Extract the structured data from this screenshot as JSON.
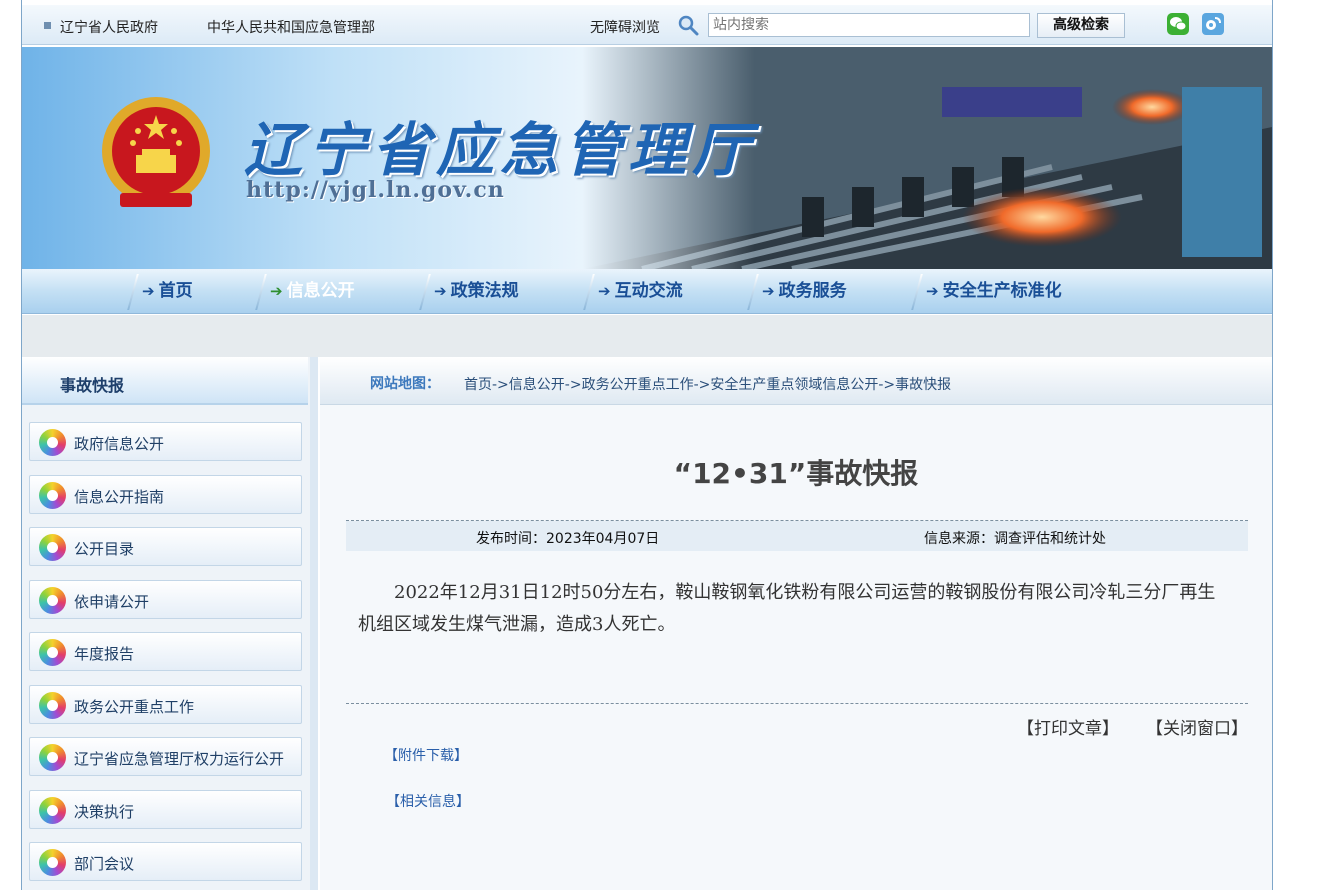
{
  "topbar": {
    "links": [
      "辽宁省人民政府",
      "中华人民共和国应急管理部"
    ],
    "accessibility": "无障碍浏览",
    "search_placeholder": "站内搜索",
    "advanced_search": "高级检索"
  },
  "banner": {
    "title": "辽宁省应急管理厅",
    "url": "http://yjgl.ln.gov.cn"
  },
  "nav": {
    "items": [
      "首页",
      "信息公开",
      "政策法规",
      "互动交流",
      "政务服务",
      "安全生产标准化"
    ],
    "active": "信息公开",
    "arrow": "➔"
  },
  "sidebar": {
    "title": "事故快报",
    "items": [
      "政府信息公开",
      "信息公开指南",
      "公开目录",
      "依申请公开",
      "年度报告",
      "政务公开重点工作",
      "辽宁省应急管理厅权力运行公开",
      "决策执行",
      "部门会议"
    ]
  },
  "main": {
    "sitemap_label": "网站地图：",
    "breadcrumb": "首页->信息公开->政务公开重点工作->安全生产重点领域信息公开->事故快报",
    "title": "“12•31”事故快报",
    "publish_date": "发布时间：2023年04月07日",
    "source": "信息来源：调查评估和统计处",
    "body": "2022年12月31日12时50分左右，鞍山鞍钢氧化铁粉有限公司运营的鞍钢股份有限公司冷轧三分厂再生机组区域发生煤气泄漏，造成3人死亡。",
    "print": "【打印文章】",
    "close": "【关闭窗口】",
    "attachment": "【附件下载】",
    "related": "【相关信息】"
  },
  "colors": {
    "nav_text": "#1a4f96",
    "title_blue": "#1f65b4",
    "link_blue": "#2a5faa"
  }
}
